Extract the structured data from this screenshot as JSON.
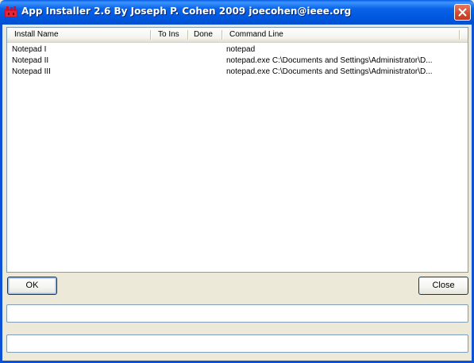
{
  "window": {
    "title": "App Installer 2.6 By Joseph P. Cohen 2009 joecohen@ieee.org",
    "icon": "app-installer-icon",
    "close_icon": "close-icon",
    "title_bar_color": "#0058e0",
    "close_button_color": "#d3462b"
  },
  "list": {
    "columns": {
      "install_name": "Install Name",
      "to_ins": "To Ins",
      "done": "Done",
      "command_line": "Command Line"
    },
    "rows": [
      {
        "name": "Notepad I",
        "to_ins": "",
        "done": "",
        "command": "notepad"
      },
      {
        "name": "Notepad II",
        "to_ins": "",
        "done": "",
        "command": "notepad.exe C:\\Documents and Settings\\Administrator\\D..."
      },
      {
        "name": "Notepad III",
        "to_ins": "",
        "done": "",
        "command": "notepad.exe C:\\Documents and Settings\\Administrator\\D..."
      }
    ]
  },
  "buttons": {
    "ok": "OK",
    "close": "Close"
  },
  "status": {
    "field1": "",
    "field2": ""
  }
}
